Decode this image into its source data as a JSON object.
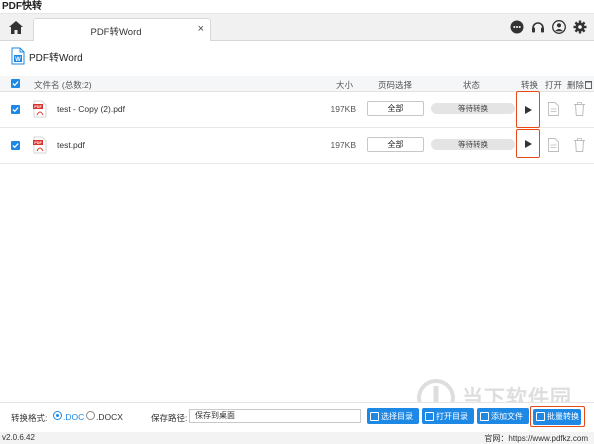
{
  "app": {
    "title": "PDF快转"
  },
  "tab": {
    "label": "PDF转Word",
    "close": "×"
  },
  "icons": {
    "home": "home-icon",
    "chat": "chat-icon",
    "headset": "headset-icon",
    "user": "user-icon",
    "settings": "gear-icon"
  },
  "page": {
    "title": "PDF转Word"
  },
  "table": {
    "headers": {
      "filename": "文件名 (总数:2)",
      "size": "大小",
      "pages": "页码选择",
      "status": "状态",
      "convert": "转换",
      "open": "打开",
      "delete": "删除"
    },
    "rows": [
      {
        "name": "test - Copy (2).pdf",
        "size": "197KB",
        "pages": "全部",
        "status": "等待转换",
        "checked": true
      },
      {
        "name": "test.pdf",
        "size": "197KB",
        "pages": "全部",
        "status": "等待转换",
        "checked": true
      }
    ]
  },
  "bottom": {
    "format_label": "转换格式:",
    "format_options": [
      ".DOC",
      ".DOCX"
    ],
    "format_selected": ".DOC",
    "path_label": "保存路径:",
    "path_value": "保存到桌面",
    "buttons": {
      "choose_dir": "选择目录",
      "open_dir": "打开目录",
      "add_file": "添加文件",
      "batch_convert": "批量转换"
    }
  },
  "footer": {
    "version": "v2.0.6.42",
    "website": "官网：https://www.pdfkz.com"
  },
  "watermark": {
    "text": "当下软件园"
  },
  "colors": {
    "accent": "#1e88e5",
    "highlight": "#e64a19",
    "pdf_red": "#d9342b"
  }
}
